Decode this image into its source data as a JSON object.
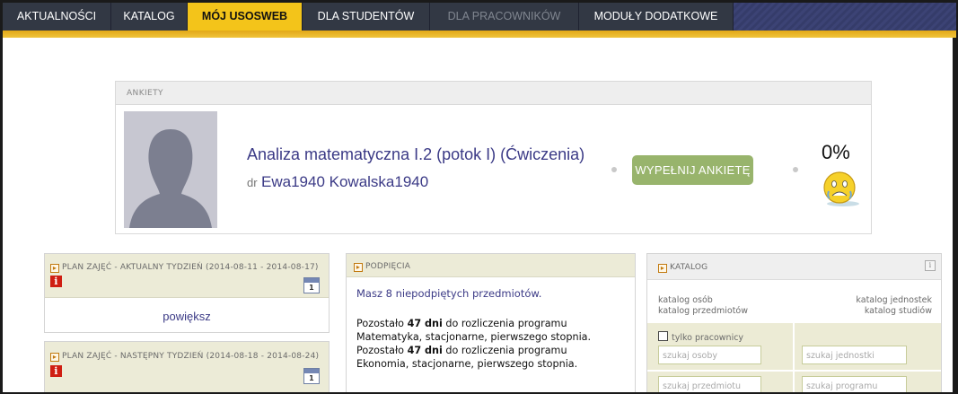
{
  "nav": {
    "tabs": [
      {
        "label": "AKTUALNOŚCI",
        "state": "normal"
      },
      {
        "label": "KATALOG",
        "state": "normal"
      },
      {
        "label": "MÓJ USOSWEB",
        "state": "active"
      },
      {
        "label": "DLA STUDENTÓW",
        "state": "normal"
      },
      {
        "label": "DLA PRACOWNIKÓW",
        "state": "disabled"
      },
      {
        "label": "MODUŁY DODATKOWE",
        "state": "normal"
      }
    ]
  },
  "survey": {
    "header": "ANKIETY",
    "subject": "Analiza matematyczna I.2 (potok I) (Ćwiczenia)",
    "teacher_prefix": "dr",
    "teacher_name": "Ewa1940 Kowalska1940",
    "button_label": "WYPEŁNIJ ANKIETĘ",
    "progress_label": "0%",
    "icon": "sad-smiley-icon"
  },
  "schedule_current": {
    "title": "PLAN ZAJĘĆ - AKTUALNY TYDZIEŃ (2014-08-11 - 2014-08-17)",
    "calendar_day": "1",
    "enlarge_link": "powiększ"
  },
  "schedule_next": {
    "title": "PLAN ZAJĘĆ - NASTĘPNY TYDZIEŃ (2014-08-18 - 2014-08-24)",
    "calendar_day": "1"
  },
  "pinning": {
    "title": "PODPIĘCIA",
    "link": "Masz 8 niepodpiętych przedmiotów",
    "link_suffix": ".",
    "lines": [
      {
        "prefix": "Pozostało ",
        "bold": "47 dni",
        "suffix": " do rozliczenia programu",
        "program": "Matematyka, stacjonarne, pierwszego stopnia."
      },
      {
        "prefix": "Pozostało ",
        "bold": "47 dni",
        "suffix": " do rozliczenia programu",
        "program": "Ekonomia, stacjonarne, pierwszego stopnia."
      }
    ]
  },
  "catalog": {
    "title": "KATALOG",
    "links": {
      "persons": "katalog osób",
      "units": "katalog jednostek",
      "subjects": "katalog przedmiotów",
      "studies": "katalog studiów"
    },
    "checkbox_label": "tylko pracownicy",
    "inputs": {
      "person_placeholder": "szukaj osoby",
      "unit_placeholder": "szukaj jednostki",
      "subject_placeholder": "szukaj przedmiotu",
      "program_placeholder": "szukaj programu"
    }
  },
  "colors": {
    "nav_active": "#f3c41a",
    "link": "#3b3a86",
    "button_green": "#98b46c",
    "panel_header": "#ecebd7",
    "info_red": "#cf1e12"
  }
}
